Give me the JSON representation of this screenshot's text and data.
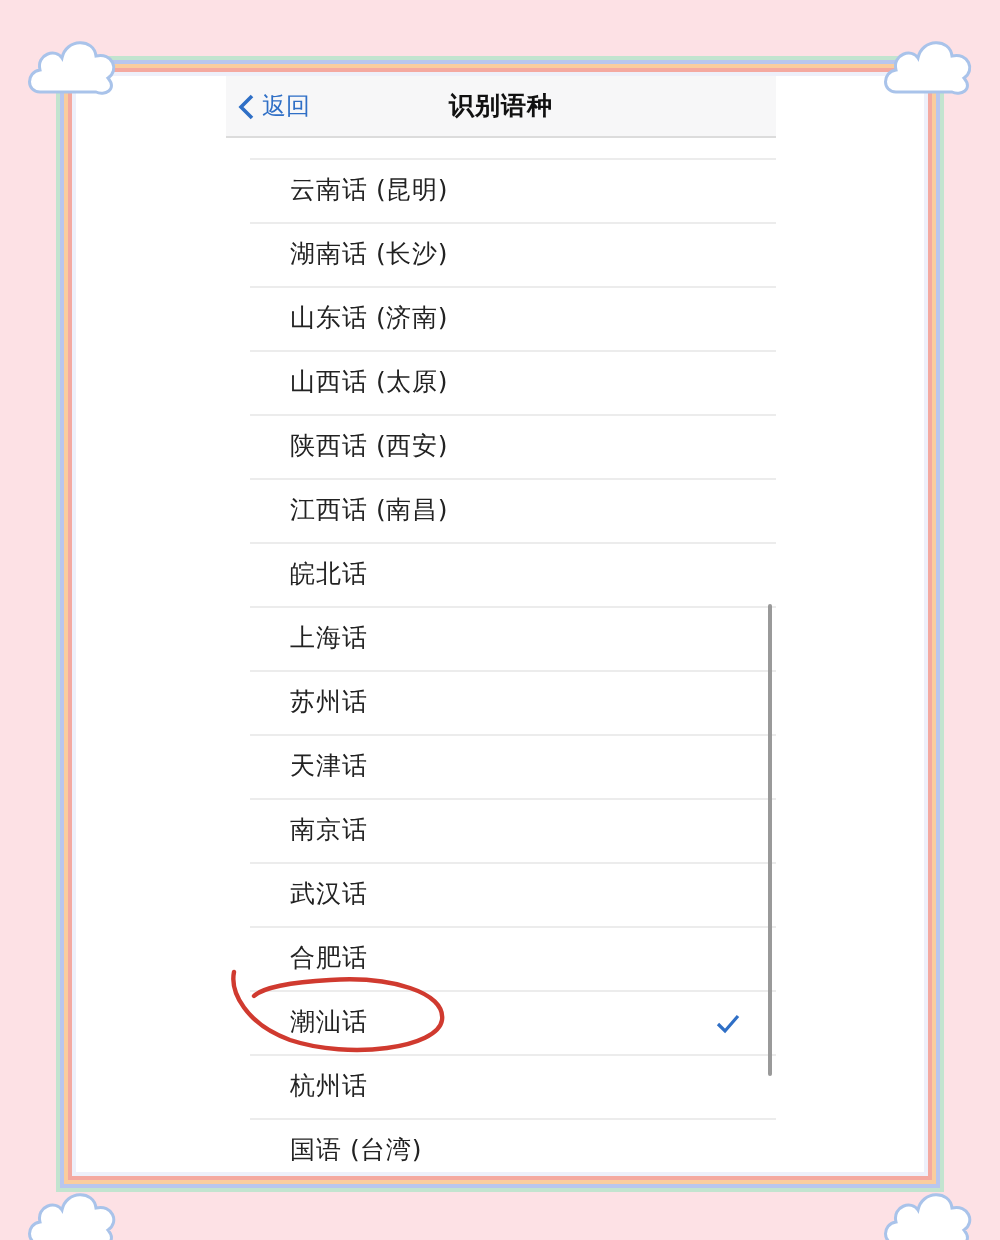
{
  "nav_bar": {
    "back_label": "返回",
    "title": "识别语种"
  },
  "items": [
    {
      "label": "云南话 (昆明)",
      "selected": false,
      "circled": false
    },
    {
      "label": "湖南话 (长沙)",
      "selected": false,
      "circled": false
    },
    {
      "label": "山东话 (济南)",
      "selected": false,
      "circled": false
    },
    {
      "label": "山西话 (太原)",
      "selected": false,
      "circled": false
    },
    {
      "label": "陕西话 (西安)",
      "selected": false,
      "circled": false
    },
    {
      "label": "江西话 (南昌)",
      "selected": false,
      "circled": false
    },
    {
      "label": "皖北话",
      "selected": false,
      "circled": false
    },
    {
      "label": "上海话",
      "selected": false,
      "circled": false
    },
    {
      "label": "苏州话",
      "selected": false,
      "circled": false
    },
    {
      "label": "天津话",
      "selected": false,
      "circled": false
    },
    {
      "label": "南京话",
      "selected": false,
      "circled": false
    },
    {
      "label": "武汉话",
      "selected": false,
      "circled": false
    },
    {
      "label": "合肥话",
      "selected": false,
      "circled": false
    },
    {
      "label": "潮汕话",
      "selected": true,
      "circled": true
    },
    {
      "label": "杭州话",
      "selected": false,
      "circled": false
    },
    {
      "label": "国语 (台湾)",
      "selected": false,
      "circled": false
    }
  ]
}
